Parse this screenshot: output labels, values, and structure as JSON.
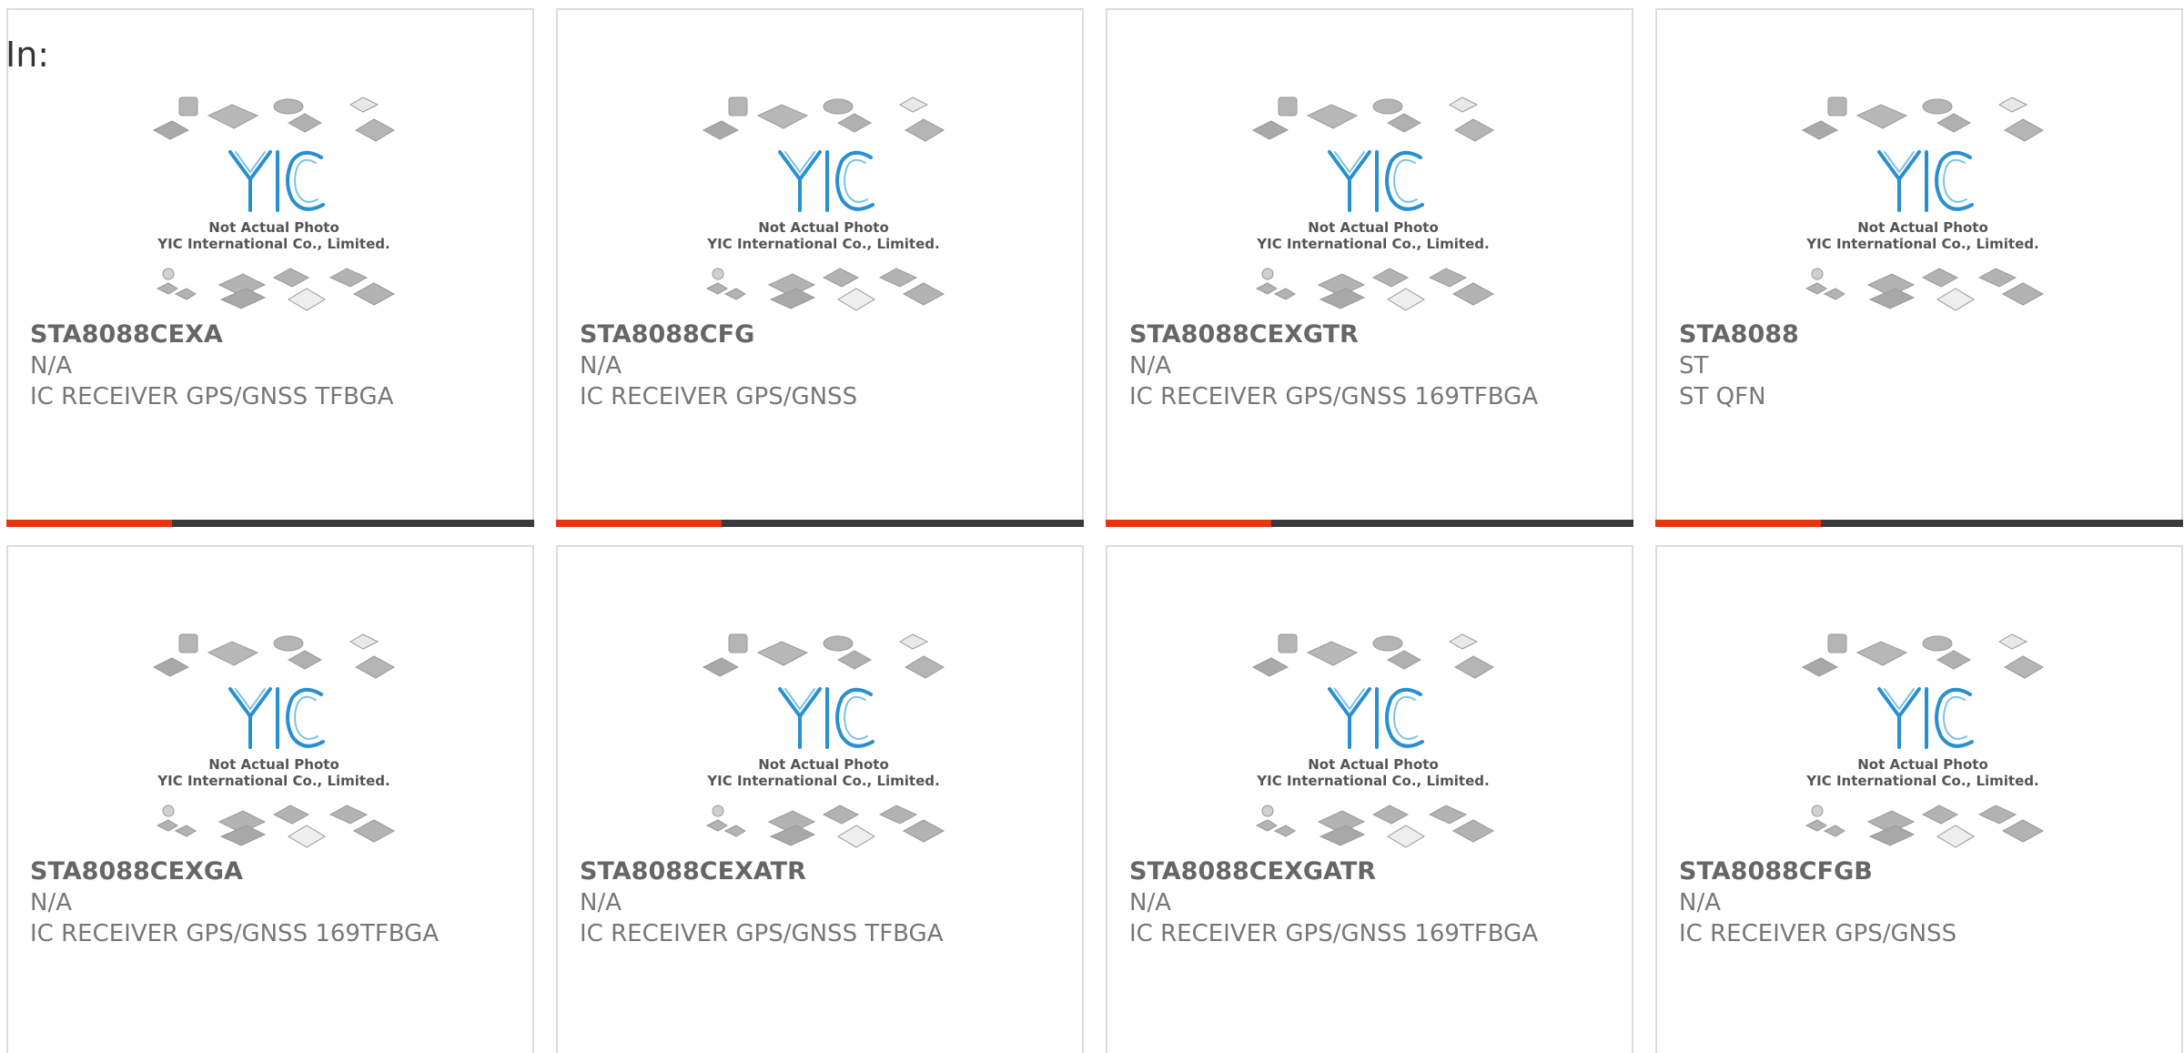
{
  "header": {
    "label": "In:"
  },
  "placeholder": {
    "brand": "YIC",
    "line1": "Not Actual Photo",
    "line2": "YIC International Co., Limited."
  },
  "colors": {
    "accent": "#e8340d",
    "bar": "#3a3a3a",
    "brand_blue": "#2a8fd0"
  },
  "products": [
    {
      "part": "STA8088CEXA",
      "manufacturer": "N/A",
      "description": "IC RECEIVER GPS/GNSS TFBGA"
    },
    {
      "part": "STA8088CFG",
      "manufacturer": "N/A",
      "description": "IC RECEIVER GPS/GNSS"
    },
    {
      "part": "STA8088CEXGTR",
      "manufacturer": "N/A",
      "description": "IC RECEIVER GPS/GNSS 169TFBGA"
    },
    {
      "part": "STA8088",
      "manufacturer": "ST",
      "description": "ST QFN"
    },
    {
      "part": "STA8088CEXGA",
      "manufacturer": "N/A",
      "description": "IC RECEIVER GPS/GNSS 169TFBGA"
    },
    {
      "part": "STA8088CEXATR",
      "manufacturer": "N/A",
      "description": "IC RECEIVER GPS/GNSS TFBGA"
    },
    {
      "part": "STA8088CEXGATR",
      "manufacturer": "N/A",
      "description": "IC RECEIVER GPS/GNSS 169TFBGA"
    },
    {
      "part": "STA8088CFGB",
      "manufacturer": "N/A",
      "description": "IC RECEIVER GPS/GNSS"
    }
  ]
}
